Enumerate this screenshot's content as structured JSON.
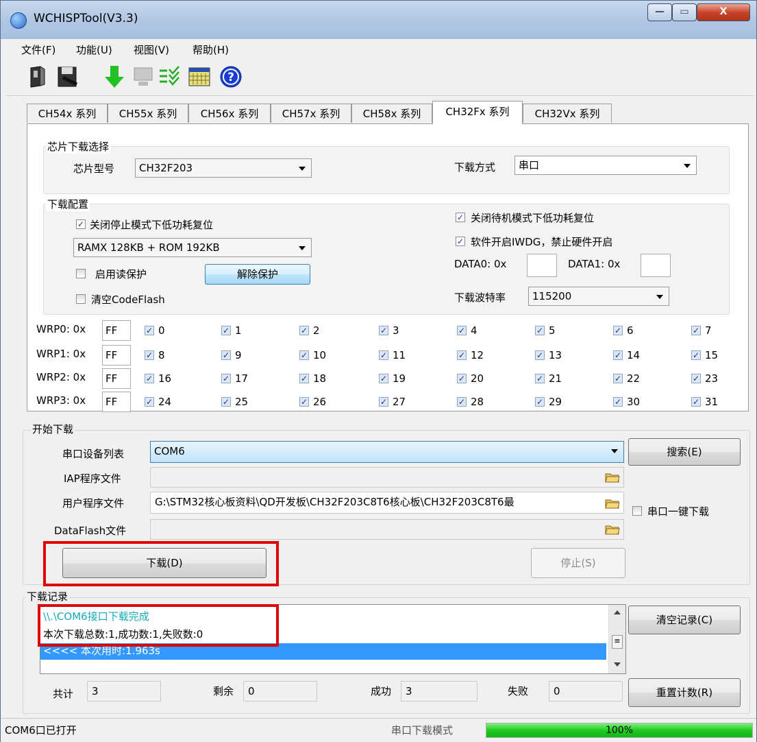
{
  "window": {
    "title": "WCHISPTool(V3.3)"
  },
  "menu": [
    "文件(F)",
    "功能(U)",
    "视图(V)",
    "帮助(H)"
  ],
  "toolbar_icons": [
    "open-icon",
    "save-icon",
    "download-icon",
    "monitor-icon",
    "list-check-icon",
    "calendar-icon",
    "help-icon"
  ],
  "tabs": [
    "CH54x 系列",
    "CH55x 系列",
    "CH56x 系列",
    "CH57x 系列",
    "CH58x 系列",
    "CH32Fx 系列",
    "CH32Vx 系列"
  ],
  "active_tab": "CH32Fx 系列",
  "chip_select": {
    "group_label": "芯片下载选择",
    "model_label": "芯片型号",
    "model_value": "CH32F203",
    "mode_label": "下载方式",
    "mode_value": "串口"
  },
  "download_config": {
    "group_label": "下载配置",
    "stop_reset_label": "关闭停止模式下低功耗复位",
    "ram_rom_value": "RAMX 128KB + ROM 192KB",
    "read_protect_label": "启用读保护",
    "unprotect_button": "解除保护",
    "clear_codeflash_label": "清空CodeFlash",
    "standby_reset_label": "关闭待机模式下低功耗复位",
    "iwdg_label": "软件开启IWDG，禁止硬件开启",
    "data0_label": "DATA0: 0x",
    "data1_label": "DATA1: 0x",
    "data0_value": "",
    "data1_value": "",
    "baud_label": "下载波特率",
    "baud_value": "115200"
  },
  "wrp": [
    {
      "label": "WRP0: 0x",
      "value": "FF",
      "bits": [
        "0",
        "1",
        "2",
        "3",
        "4",
        "5",
        "6",
        "7"
      ]
    },
    {
      "label": "WRP1: 0x",
      "value": "FF",
      "bits": [
        "8",
        "9",
        "10",
        "11",
        "12",
        "13",
        "14",
        "15"
      ]
    },
    {
      "label": "WRP2: 0x",
      "value": "FF",
      "bits": [
        "16",
        "17",
        "18",
        "19",
        "20",
        "21",
        "22",
        "23"
      ]
    },
    {
      "label": "WRP3: 0x",
      "value": "FF",
      "bits": [
        "24",
        "25",
        "26",
        "27",
        "28",
        "29",
        "30",
        "31"
      ]
    }
  ],
  "start": {
    "group_label": "开始下载",
    "port_label": "串口设备列表",
    "port_value": "COM6",
    "search_button": "搜索(E)",
    "iap_label": "IAP程序文件",
    "iap_value": "",
    "user_label": "用户程序文件",
    "user_value": "G:\\STM32核心板资料\\QD开发板\\CH32F203C8T6核心板\\CH32F203C8T6最",
    "oneclick_label": "串口一键下载",
    "dataflash_label": "DataFlash文件",
    "dataflash_value": "",
    "download_button": "下载(D)",
    "stop_button": "停止(S)"
  },
  "log": {
    "group_label": "下载记录",
    "lines": [
      "\\\\.\\COM6接口下载完成",
      "本次下载总数:1,成功数:1,失败数:0",
      "<<<< 本次用时:1.963s"
    ],
    "clear_button": "清空记录(C)"
  },
  "counters": {
    "total_label": "共计",
    "total_value": "3",
    "remain_label": "剩余",
    "remain_value": "0",
    "success_label": "成功",
    "success_value": "3",
    "fail_label": "失败",
    "fail_value": "0",
    "reset_button": "重置计数(R)"
  },
  "status": {
    "port_status": "COM6口已打开",
    "mode": "串口下载模式",
    "progress_text": "100%",
    "progress": 1.0
  },
  "colors": {
    "accent": "#3399ff",
    "log_cyan": "#17a9b9",
    "progress_green": "#1fcb1f",
    "highlight": "#e00000"
  }
}
